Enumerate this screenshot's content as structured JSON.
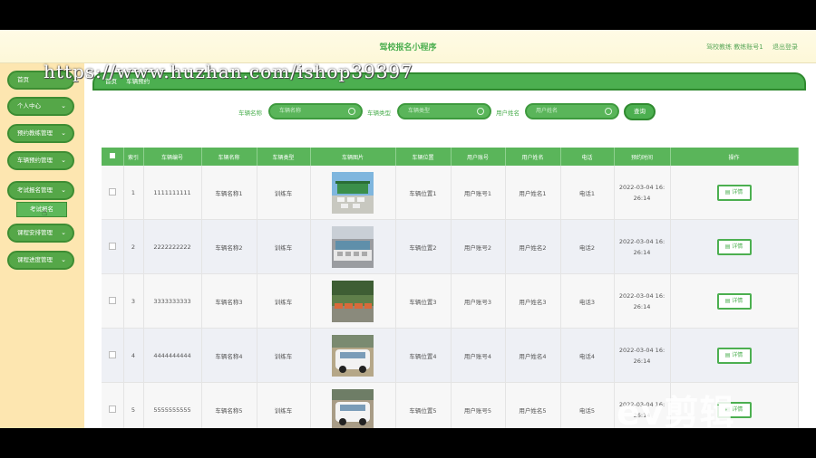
{
  "app": {
    "title": "驾校报名小程序",
    "user_label": "驾校教练 教练账号1",
    "logout_label": "退出登录"
  },
  "watermark": "https://www.huzhan.com/ishop39397",
  "sidebar": {
    "items": [
      {
        "label": "首页",
        "chevron": false
      },
      {
        "label": "个人中心",
        "chevron": true
      },
      {
        "label": "预约教练管理",
        "chevron": true
      },
      {
        "label": "车辆预约管理",
        "chevron": true
      },
      {
        "label": "考试报名管理",
        "chevron": true
      },
      {
        "label": "课程安排管理",
        "chevron": true
      },
      {
        "label": "课程进度管理",
        "chevron": true
      }
    ],
    "submenu_item": "考试报名"
  },
  "breadcrumb": [
    "首页",
    "车辆预约"
  ],
  "search": {
    "fields": [
      {
        "label": "车辆名称",
        "placeholder": "车辆名称"
      },
      {
        "label": "车辆类型",
        "placeholder": "车辆类型"
      },
      {
        "label": "用户姓名",
        "placeholder": "用户姓名"
      }
    ],
    "button_label": "查询"
  },
  "table": {
    "columns": [
      "索引",
      "车辆编号",
      "车辆名称",
      "车辆类型",
      "车辆图片",
      "车辆位置",
      "用户账号",
      "用户姓名",
      "电话",
      "预约时间",
      "操作"
    ],
    "detail_label": "详情",
    "rows": [
      {
        "index": "1",
        "vehicle_no": "1111111111",
        "vehicle_name": "车辆名称1",
        "vehicle_type": "训练车",
        "location": "车辆位置1",
        "account": "用户账号1",
        "user_name": "用户姓名1",
        "phone": "电话1",
        "time_line1": "2022-03-04 16:",
        "time_line2": "26:14"
      },
      {
        "index": "2",
        "vehicle_no": "2222222222",
        "vehicle_name": "车辆名称2",
        "vehicle_type": "训练车",
        "location": "车辆位置2",
        "account": "用户账号2",
        "user_name": "用户姓名2",
        "phone": "电话2",
        "time_line1": "2022-03-04 16:",
        "time_line2": "26:14"
      },
      {
        "index": "3",
        "vehicle_no": "3333333333",
        "vehicle_name": "车辆名称3",
        "vehicle_type": "训练车",
        "location": "车辆位置3",
        "account": "用户账号3",
        "user_name": "用户姓名3",
        "phone": "电话3",
        "time_line1": "2022-03-04 16:",
        "time_line2": "26:14"
      },
      {
        "index": "4",
        "vehicle_no": "4444444444",
        "vehicle_name": "车辆名称4",
        "vehicle_type": "训练车",
        "location": "车辆位置4",
        "account": "用户账号4",
        "user_name": "用户姓名4",
        "phone": "电话4",
        "time_line1": "2022-03-04 16:",
        "time_line2": "26:14"
      },
      {
        "index": "5",
        "vehicle_no": "5555555555",
        "vehicle_name": "车辆名称5",
        "vehicle_type": "训练车",
        "location": "车辆位置5",
        "account": "用户账号5",
        "user_name": "用户姓名5",
        "phone": "电话5",
        "time_line1": "2022-03-04 16:",
        "time_line2": "26:14"
      }
    ]
  },
  "overlay_logo": "ev剪辑",
  "colors": {
    "primary": "#4caf50",
    "sidebar_bg": "#fde6b0",
    "header_bg": "#fffbe6"
  }
}
